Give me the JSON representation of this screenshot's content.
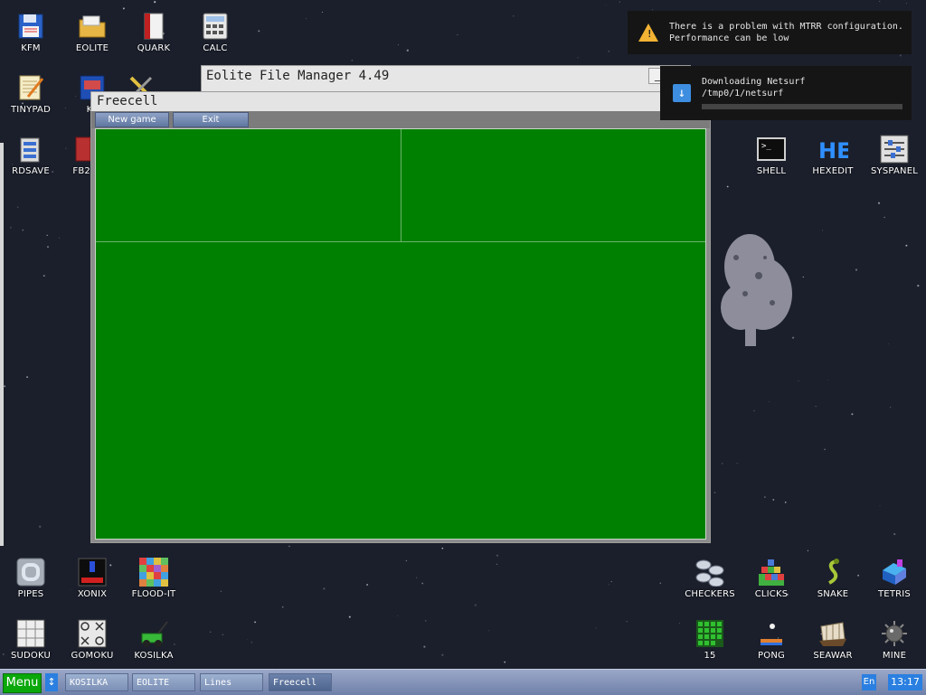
{
  "desktop_icons_left": [
    {
      "label": "KFM",
      "icon": "floppy-icon"
    },
    {
      "label": "EOLITE",
      "icon": "folder-icon"
    },
    {
      "label": "QUARK",
      "icon": "book-icon"
    },
    {
      "label": "CALC",
      "icon": "calculator-icon"
    },
    {
      "label": "TINYPAD",
      "icon": "notepad-icon"
    },
    {
      "label": "KF",
      "icon": "kf-icon"
    },
    {
      "label": "RDSAVE",
      "icon": "rdsave-icon"
    },
    {
      "label": "FB2",
      "icon": "fb2-icon"
    }
  ],
  "desktop_icons_right": [
    {
      "label": "SHELL",
      "icon": "terminal-icon"
    },
    {
      "label": "HEXEDIT",
      "icon": "hexedit-icon"
    },
    {
      "label": "SYSPANEL",
      "icon": "syspanel-icon"
    }
  ],
  "desktop_icons_bottom_left": [
    {
      "label": "PIPES",
      "icon": "pipes-icon"
    },
    {
      "label": "XONIX",
      "icon": "xonix-icon"
    },
    {
      "label": "FLOOD-IT",
      "icon": "flood-it-icon"
    },
    {
      "label": "SUDOKU",
      "icon": "sudoku-icon"
    },
    {
      "label": "GOMOKU",
      "icon": "gomoku-icon"
    },
    {
      "label": "KOSILKA",
      "icon": "lawnmower-icon"
    }
  ],
  "desktop_icons_bottom_right": [
    {
      "label": "CHECKERS",
      "icon": "checkers-icon"
    },
    {
      "label": "CLICKS",
      "icon": "clicks-icon"
    },
    {
      "label": "SNAKE",
      "icon": "snake-icon"
    },
    {
      "label": "TETRIS",
      "icon": "tetris-icon"
    },
    {
      "label": "15",
      "icon": "fifteen-icon"
    },
    {
      "label": "PONG",
      "icon": "pong-icon"
    },
    {
      "label": "SEAWAR",
      "icon": "ship-icon"
    },
    {
      "label": "MINE",
      "icon": "mine-icon"
    }
  ],
  "file_manager": {
    "title": "Eolite File Manager 4.49",
    "min_label": "_"
  },
  "freecell": {
    "title": "Freecell",
    "new_game_label": "New game",
    "exit_label": "Exit"
  },
  "notifications": [
    {
      "line1": "There is a problem with MTRR configuration.",
      "line2": "Performance can be low"
    },
    {
      "line1": "Downloading Netsurf",
      "line2": "/tmp0/1/netsurf",
      "progress": 0
    }
  ],
  "taskbar": {
    "menu_label": "Menu",
    "arrow_label": "↕",
    "tasks": [
      "KOSILKA",
      "EOLITE",
      "Lines",
      "Freecell"
    ],
    "lang": "En",
    "clock": "13:17"
  }
}
